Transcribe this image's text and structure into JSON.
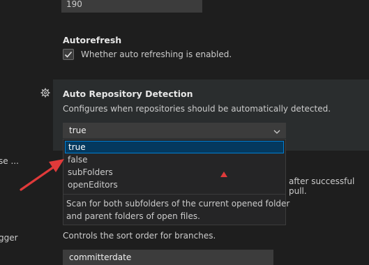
{
  "top_input": {
    "value": "190"
  },
  "autorefresh": {
    "title": "Autorefresh",
    "checkbox_label": "Whether auto refreshing is enabled.",
    "checked": true
  },
  "auto_repo_detection": {
    "title": "Auto Repository Detection",
    "description": "Configures when repositories should be automatically detected.",
    "selected": "true",
    "options": [
      "true",
      "false",
      "subFolders",
      "openEditors"
    ],
    "option_description_line1": "Scan for both subfolders of the current opened folder",
    "option_description_line2": "and parent folders of open files."
  },
  "left_truncated": {
    "a": "se ...",
    "b": "gger"
  },
  "behind_text": "after successful pull.",
  "branch_sort": {
    "description": "Controls the sort order for branches.",
    "value": "committerdate"
  },
  "colors": {
    "background": "#1e1e1e",
    "focused_row": "#2a2d2e",
    "accent": "#007fd4",
    "annotation": "#e03a3a"
  }
}
